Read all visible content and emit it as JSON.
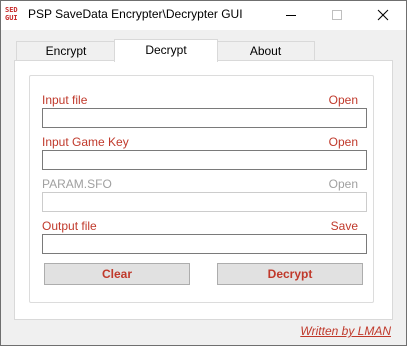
{
  "window": {
    "title": "PSP SaveData Encrypter\\Decrypter GUI",
    "icon_lines": [
      "SED",
      "GUI"
    ],
    "icon": "app-icon"
  },
  "controls": {
    "minimize_icon": "minimize-icon",
    "maximize_icon": "maximize-icon",
    "close_icon": "close-icon"
  },
  "tabs": [
    {
      "label": "Encrypt",
      "active": false
    },
    {
      "label": "Decrypt",
      "active": true
    },
    {
      "label": "About",
      "active": false
    }
  ],
  "form": {
    "input_file": {
      "label": "Input file",
      "action": "Open",
      "value": ""
    },
    "game_key": {
      "label": "Input Game Key",
      "action": "Open",
      "value": ""
    },
    "param_sfo": {
      "label": "PARAM.SFO",
      "action": "Open",
      "value": "",
      "disabled": true
    },
    "output_file": {
      "label": "Output file",
      "action": "Save",
      "value": ""
    }
  },
  "buttons": {
    "clear": "Clear",
    "decrypt": "Decrypt"
  },
  "footer": {
    "credit": "Written by LMAN"
  },
  "colors": {
    "accent": "#c0392b",
    "disabled": "#a0a0a0"
  }
}
